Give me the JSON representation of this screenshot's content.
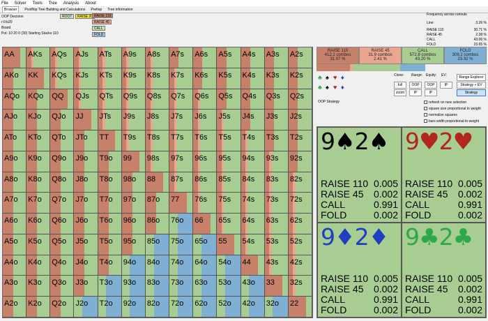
{
  "menu": [
    "File",
    "Solver",
    "Tools",
    "Tree",
    "Analysis",
    "About"
  ],
  "tabs": [
    "Browser",
    "Postflop Tree Building and Calculations",
    "Prefiop",
    "Tree information"
  ],
  "info": {
    "decision": "OOP Decision",
    "hand": "r:0:b20",
    "board_label": "Board",
    "pot": "Pot: 10 20 0 (30) Starting Stacks 110"
  },
  "tree": {
    "root": "ROOT",
    "raise20": "RAISE 20",
    "raise110": "RAISE 110",
    "raise45": "RAISE 45",
    "call": "CALL",
    "fold": "FOLD"
  },
  "freq_panel": {
    "title": "Frequency across runouts",
    "rows": [
      [
        "Line:",
        "3.26 %"
      ],
      [
        "RAISE 110",
        "30.71 %"
      ],
      [
        "RAISE 45",
        "2.38 %"
      ],
      [
        "CALL",
        "43.06 %"
      ],
      [
        "FOLD",
        "23.65 %"
      ]
    ]
  },
  "colors": {
    "raise_big": "#c7806a",
    "raise_small": "#eaa68e",
    "call": "#a7cd93",
    "fold": "#7fb0d4"
  },
  "actions": [
    {
      "name": "RAISE 110",
      "combos": "412.1 combos",
      "pct": "31.07 %",
      "color": "#c7806a"
    },
    {
      "name": "RAISE 45",
      "combos": "31.9 combos",
      "pct": "2.41 %",
      "color": "#eaa68e"
    },
    {
      "name": "CALL",
      "combos": "572.8 combos",
      "pct": "43.20 %",
      "color": "#a7cd93"
    },
    {
      "name": "FOLD",
      "combos": "309.2 combos",
      "pct": "23.32 %",
      "color": "#7fb0d4"
    }
  ],
  "controls": {
    "clone": "Clone:",
    "range": "Range:",
    "equity": "Equity:",
    "ev": "EV:",
    "full": "full",
    "oop": "OOP",
    "oop2": "OOP",
    "ip": "IP",
    "zoom": "zoom",
    "ip2": "IP",
    "ip3": "IP",
    "range_explorer": "Range Explorer",
    "strategy_ev": "Strategy + EV",
    "strategy": "Strategy"
  },
  "checks": [
    "refresh on new selection",
    "square size proportional to weight",
    "normalize squares",
    "bars width proportional to weight"
  ],
  "oop_strategy": "OOP Strategy",
  "grid": [
    [
      "AA",
      "AKs",
      "AQs",
      "AJs",
      "ATs",
      "A9s",
      "A8s",
      "A7s",
      "A6s",
      "A5s",
      "A4s",
      "A3s",
      "A2s"
    ],
    [
      "AKo",
      "KK",
      "KQs",
      "KJs",
      "KTs",
      "K9s",
      "K8s",
      "K7s",
      "K6s",
      "K5s",
      "K4s",
      "K3s",
      "K2s"
    ],
    [
      "AQo",
      "KQo",
      "QQ",
      "QJs",
      "QTs",
      "Q9s",
      "Q8s",
      "Q7s",
      "Q6s",
      "Q5s",
      "Q4s",
      "Q3s",
      "Q2s"
    ],
    [
      "AJo",
      "KJo",
      "QJo",
      "JJ",
      "JTs",
      "J9s",
      "J8s",
      "J7s",
      "J6s",
      "J5s",
      "J4s",
      "J3s",
      "J2s"
    ],
    [
      "ATo",
      "KTo",
      "QTo",
      "JTo",
      "TT",
      "T9s",
      "T8s",
      "T7s",
      "T6s",
      "T5s",
      "T4s",
      "T3s",
      "T2s"
    ],
    [
      "A9o",
      "K9o",
      "Q9o",
      "J9o",
      "T9o",
      "99",
      "98s",
      "97s",
      "96s",
      "95s",
      "94s",
      "93s",
      "92s"
    ],
    [
      "A8o",
      "K8o",
      "Q8o",
      "J8o",
      "T8o",
      "98o",
      "88",
      "87s",
      "86s",
      "85s",
      "84s",
      "83s",
      "82s"
    ],
    [
      "A7o",
      "K7o",
      "Q7o",
      "J7o",
      "T7o",
      "97o",
      "87o",
      "77",
      "76s",
      "75s",
      "74s",
      "73s",
      "72s"
    ],
    [
      "A6o",
      "K6o",
      "Q6o",
      "J6o",
      "T6o",
      "96o",
      "86o",
      "76o",
      "66",
      "65s",
      "64s",
      "63s",
      "62s"
    ],
    [
      "A5o",
      "K5o",
      "Q5o",
      "J5o",
      "T5o",
      "95o",
      "85o",
      "75o",
      "65o",
      "55",
      "54s",
      "53s",
      "52s"
    ],
    [
      "A4o",
      "K4o",
      "Q4o",
      "J4o",
      "T4o",
      "94o",
      "84o",
      "74o",
      "64o",
      "54o",
      "44",
      "43s",
      "42s"
    ],
    [
      "A3o",
      "K3o",
      "Q3o",
      "J3o",
      "T3o",
      "93o",
      "83o",
      "73o",
      "63o",
      "53o",
      "43o",
      "33",
      "32s"
    ],
    [
      "A2o",
      "K2o",
      "Q2o",
      "J2o",
      "T2o",
      "92o",
      "82o",
      "72o",
      "62o",
      "52o",
      "42o",
      "32o",
      "22"
    ]
  ],
  "combos": [
    {
      "rank1": "9",
      "suit1": "♠",
      "rank2": "2",
      "suit2": "♠",
      "color": "#000000",
      "raise110": "0.005",
      "raise45": "0.002",
      "call": "0.991",
      "fold": "0.002"
    },
    {
      "rank1": "9",
      "suit1": "♥",
      "rank2": "2",
      "suit2": "♥",
      "color": "#b3261e",
      "raise110": "0.005",
      "raise45": "0.002",
      "call": "0.991",
      "fold": "0.002"
    },
    {
      "rank1": "9",
      "suit1": "♦",
      "rank2": "2",
      "suit2": "♦",
      "color": "#1f3fbf",
      "raise110": "0.005",
      "raise45": "0.002",
      "call": "0.991",
      "fold": "0.002"
    },
    {
      "rank1": "9",
      "suit1": "♣",
      "rank2": "2",
      "suit2": "♣",
      "color": "#2ea84a",
      "raise110": "0.005",
      "raise45": "0.002",
      "call": "0.991",
      "fold": "0.002"
    }
  ],
  "combo_labels": {
    "raise110": "RAISE 110",
    "raise45": "RAISE 45",
    "call": "CALL",
    "fold": "FOLD"
  }
}
